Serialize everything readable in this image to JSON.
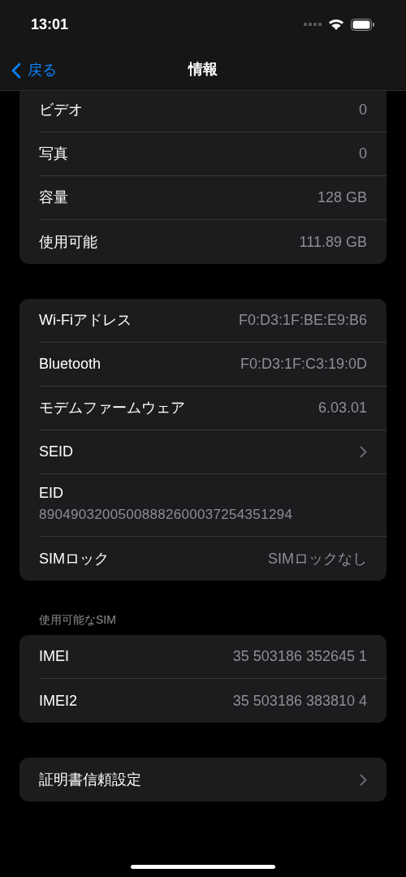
{
  "status_bar": {
    "time": "13:01"
  },
  "nav": {
    "back": "戻る",
    "title": "情報"
  },
  "groups": [
    {
      "rows": [
        {
          "kind": "value",
          "label": "ビデオ",
          "value": "0"
        },
        {
          "kind": "value",
          "label": "写真",
          "value": "0"
        },
        {
          "kind": "value",
          "label": "容量",
          "value": "128 GB"
        },
        {
          "kind": "value",
          "label": "使用可能",
          "value": "111.89 GB"
        }
      ]
    },
    {
      "rows": [
        {
          "kind": "value",
          "label": "Wi-Fiアドレス",
          "value": "F0:D3:1F:BE:E9:B6"
        },
        {
          "kind": "value",
          "label": "Bluetooth",
          "value": "F0:D3:1F:C3:19:0D"
        },
        {
          "kind": "value",
          "label": "モデムファームウェア",
          "value": "6.03.01"
        },
        {
          "kind": "chevron",
          "label": "SEID"
        },
        {
          "kind": "stacked",
          "label": "EID",
          "value": "89049032005008882600037254351294"
        },
        {
          "kind": "value",
          "label": "SIMロック",
          "value": "SIMロックなし"
        }
      ]
    },
    {
      "header": "使用可能なSIM",
      "rows": [
        {
          "kind": "value",
          "label": "IMEI",
          "value": "35 503186 352645 1"
        },
        {
          "kind": "value",
          "label": "IMEI2",
          "value": "35 503186 383810 4"
        }
      ]
    },
    {
      "rows": [
        {
          "kind": "chevron",
          "label": "証明書信頼設定"
        }
      ]
    }
  ]
}
